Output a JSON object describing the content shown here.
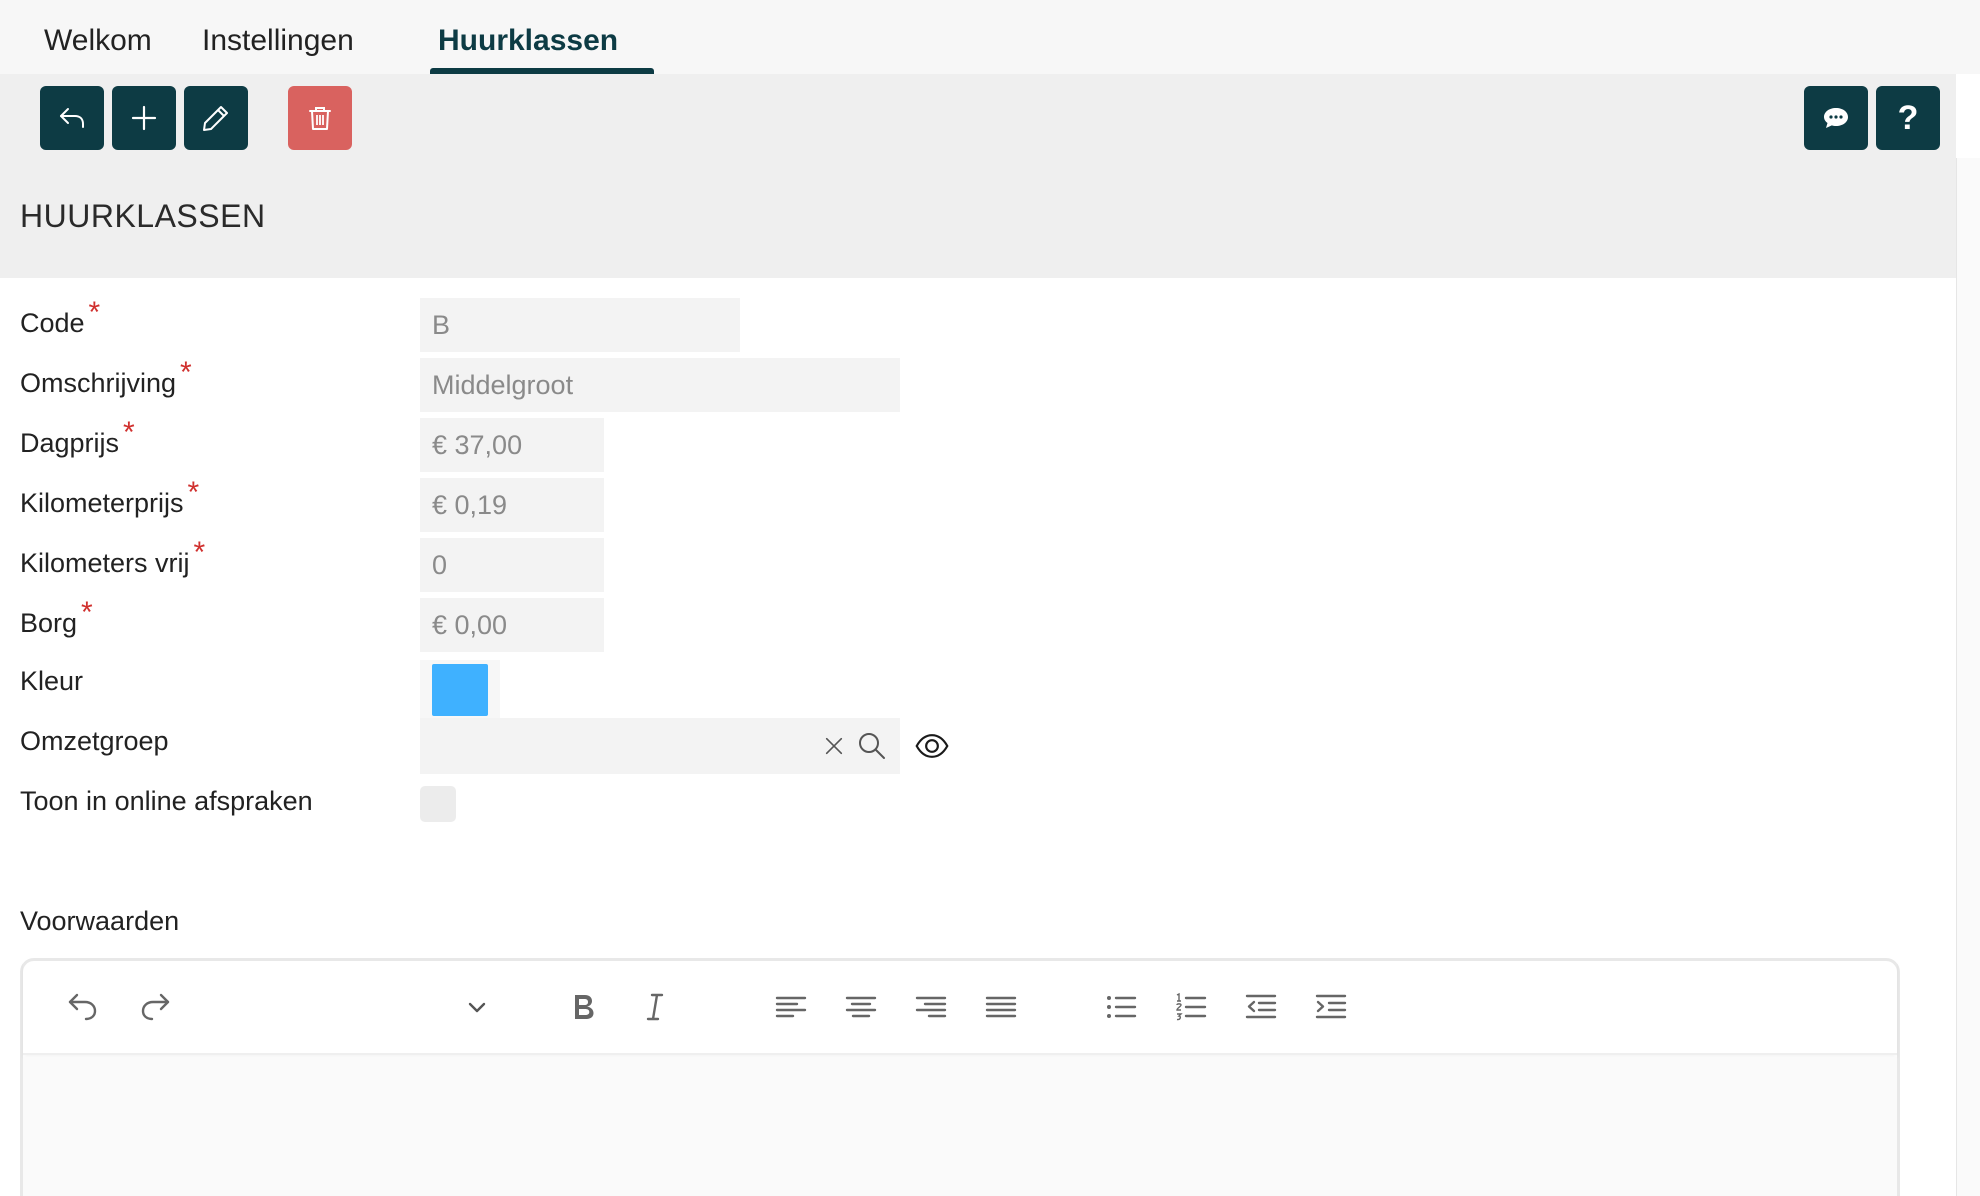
{
  "tabs": [
    {
      "label": "Welkom",
      "active": false
    },
    {
      "label": "Instellingen",
      "active": false
    },
    {
      "label": "Huurklassen",
      "active": true
    }
  ],
  "toolbar": {
    "back": "back-icon",
    "add": "plus-icon",
    "edit": "pencil-icon",
    "delete": "trash-icon",
    "comments": "chat-icon",
    "help": "?"
  },
  "page": {
    "title": "HUURKLASSEN"
  },
  "form": {
    "code": {
      "label": "Code",
      "value": "B",
      "required": true
    },
    "omschrijving": {
      "label": "Omschrijving",
      "value": "Middelgroot",
      "required": true
    },
    "dagprijs": {
      "label": "Dagprijs",
      "value": "€ 37,00",
      "required": true
    },
    "kilometerprijs": {
      "label": "Kilometerprijs",
      "value": "€ 0,19",
      "required": true
    },
    "kilometers_vrij": {
      "label": "Kilometers vrij",
      "value": "0",
      "required": true
    },
    "borg": {
      "label": "Borg",
      "value": "€ 0,00",
      "required": true
    },
    "kleur": {
      "label": "Kleur",
      "color": "#3fb1ff"
    },
    "omzetgroep": {
      "label": "Omzetgroep",
      "value": ""
    },
    "toon_online": {
      "label": "Toon in online afspraken",
      "checked": false
    }
  },
  "required_mark": "*",
  "voorwaarden": {
    "label": "Voorwaarden",
    "content": ""
  },
  "colors": {
    "primary": "#0d3b44",
    "danger": "#d9625f",
    "required": "#d0302e"
  }
}
